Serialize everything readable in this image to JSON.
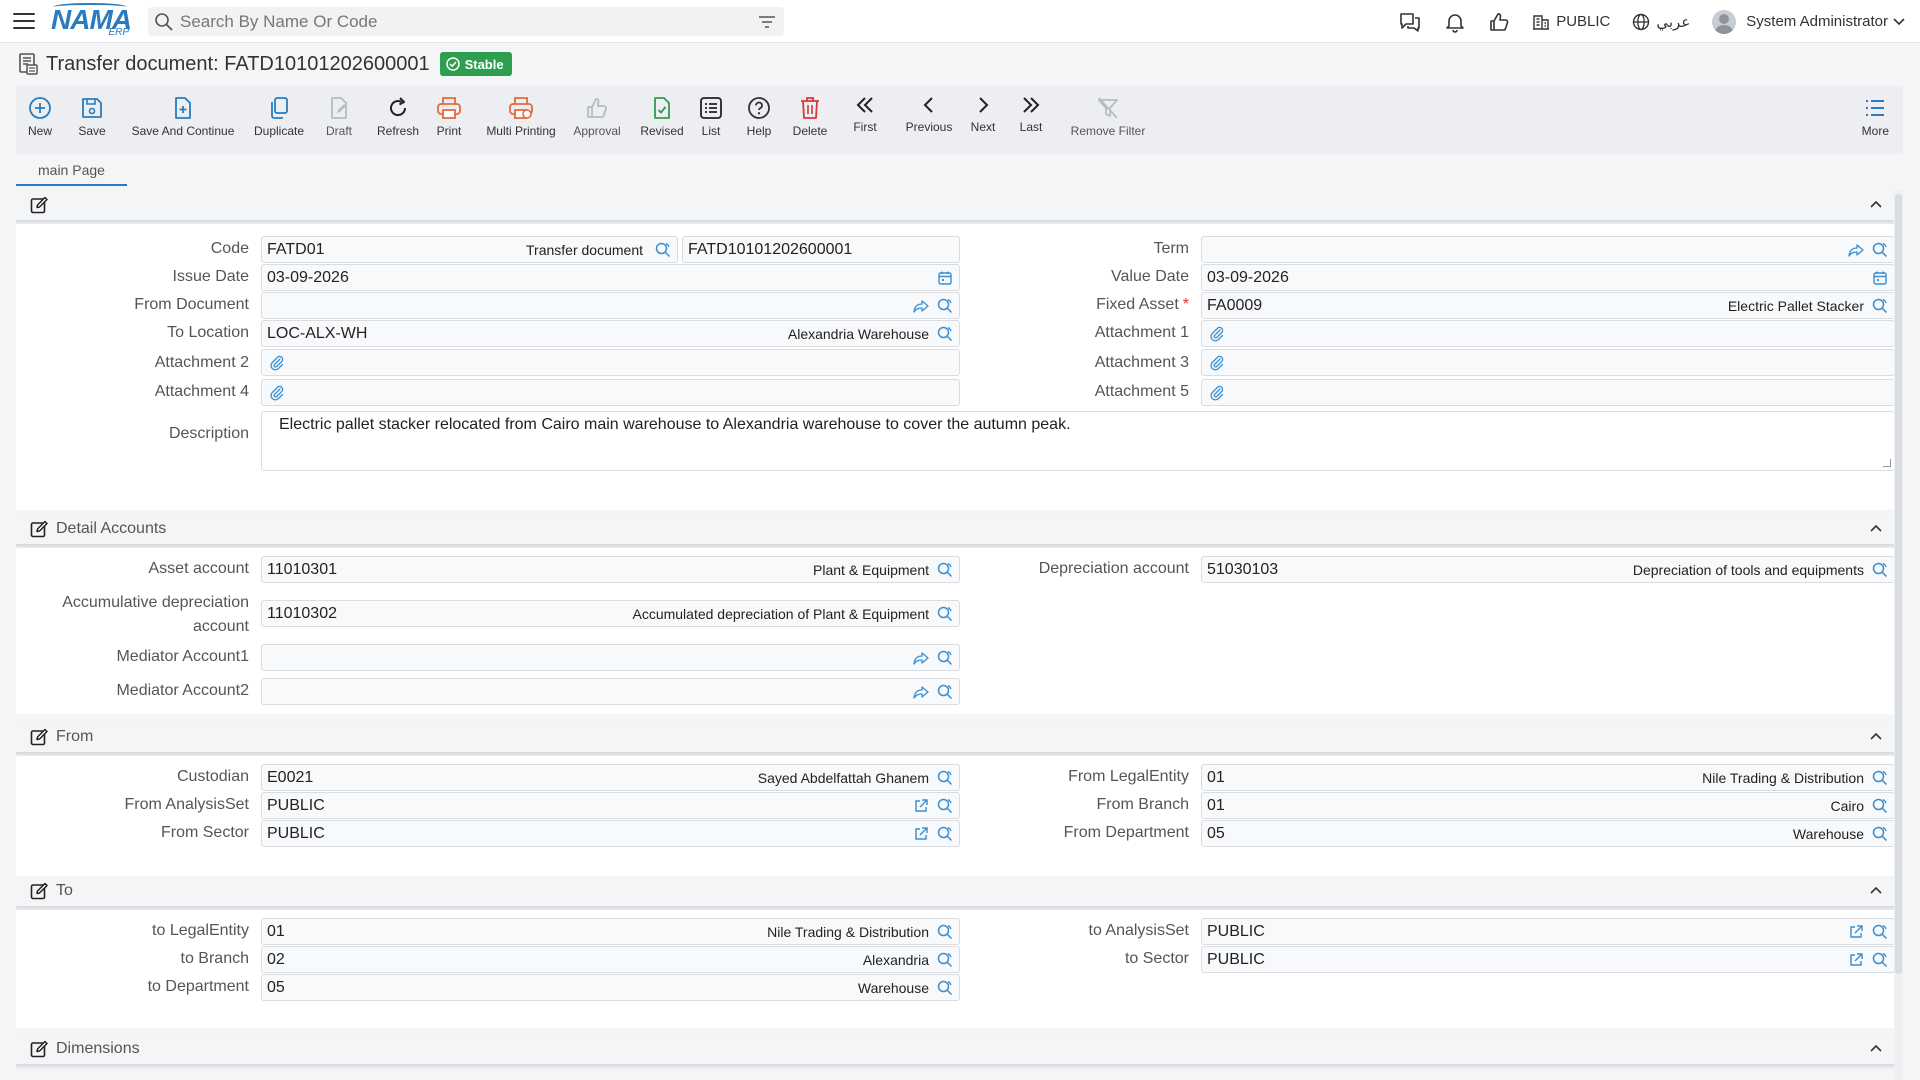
{
  "app": {
    "logo_text": "NAMA",
    "logo_sub": "ERP",
    "search_placeholder": "Search By Name Or Code",
    "org_label": "PUBLIC",
    "language_label": "عربي",
    "user_name": "System Administrator"
  },
  "page": {
    "title": "Transfer document: FATD10101202600001",
    "status": "Stable",
    "status_color": "#2e9e4f"
  },
  "toolbar": [
    {
      "id": "new",
      "label": "New",
      "icon": "plus-circle-icon"
    },
    {
      "id": "save",
      "label": "Save",
      "icon": "save-icon"
    },
    {
      "id": "save-continue",
      "label": "Save And Continue",
      "icon": "save-continue-icon"
    },
    {
      "id": "duplicate",
      "label": "Duplicate",
      "icon": "duplicate-icon"
    },
    {
      "id": "draft",
      "label": "Draft",
      "icon": "draft-icon"
    },
    {
      "id": "refresh",
      "label": "Refresh",
      "icon": "refresh-icon"
    },
    {
      "id": "print",
      "label": "Print",
      "icon": "printer-icon"
    },
    {
      "id": "multi-print",
      "label": "Multi Printing",
      "icon": "multi-printer-icon"
    },
    {
      "id": "approval",
      "label": "Approval",
      "icon": "thumbs-up-icon"
    },
    {
      "id": "revised",
      "label": "Revised",
      "icon": "revised-icon"
    },
    {
      "id": "list",
      "label": "List",
      "icon": "list-icon"
    },
    {
      "id": "help",
      "label": "Help",
      "icon": "help-icon"
    },
    {
      "id": "delete",
      "label": "Delete",
      "icon": "trash-icon"
    },
    {
      "id": "first",
      "label": "First",
      "icon": "double-chevron-left-icon"
    },
    {
      "id": "previous",
      "label": "Previous",
      "icon": "chevron-left-icon"
    },
    {
      "id": "next",
      "label": "Next",
      "icon": "chevron-right-icon"
    },
    {
      "id": "last",
      "label": "Last",
      "icon": "double-chevron-right-icon"
    },
    {
      "id": "remove-filter",
      "label": "Remove Filter",
      "icon": "remove-filter-icon"
    }
  ],
  "more_label": "More",
  "tabs": [
    {
      "label": "main Page"
    }
  ],
  "sections": {
    "detail_accounts": "Detail Accounts",
    "from": "From",
    "to": "To",
    "dimensions": "Dimensions"
  },
  "fields": {
    "code_label": "Code",
    "code_value": "FATD01",
    "code_desc": "Transfer document",
    "code_number": "FATD10101202600001",
    "term_label": "Term",
    "issue_date_label": "Issue Date",
    "issue_date_value": "03-09-2026",
    "value_date_label": "Value Date",
    "value_date_value": "03-09-2026",
    "from_document_label": "From Document",
    "fixed_asset_label": "Fixed Asset",
    "fixed_asset_required": "*",
    "fixed_asset_value": "FA0009",
    "fixed_asset_desc": "Electric Pallet Stacker",
    "to_location_label": "To Location",
    "to_location_value": "LOC-ALX-WH",
    "to_location_desc": "Alexandria Warehouse",
    "attachment1_label": "Attachment 1",
    "attachment2_label": "Attachment 2",
    "attachment3_label": "Attachment 3",
    "attachment4_label": "Attachment 4",
    "attachment5_label": "Attachment 5",
    "description_label": "Description",
    "description_value": "Electric pallet stacker relocated from Cairo main warehouse to Alexandria warehouse to cover the autumn peak.",
    "asset_account_label": "Asset account",
    "asset_account_value": "11010301",
    "asset_account_desc": "Plant & Equipment",
    "depreciation_account_label": "Depreciation account",
    "depreciation_account_value": "51030103",
    "depreciation_account_desc": "Depreciation of tools and equipments",
    "accum_dep_label_1": "Accumulative depreciation",
    "accum_dep_label_2": "account",
    "accum_dep_value": "11010302",
    "accum_dep_desc": "Accumulated depreciation of Plant & Equipment",
    "mediator1_label": "Mediator Account1",
    "mediator2_label": "Mediator Account2",
    "custodian_label": "Custodian",
    "custodian_value": "E0021",
    "custodian_desc": "Sayed Abdelfattah Ghanem",
    "from_legal_label": "From LegalEntity",
    "from_legal_value": "01",
    "from_legal_desc": "Nile Trading & Distribution",
    "from_analysis_label": "From AnalysisSet",
    "from_analysis_value": "PUBLIC",
    "from_branch_label": "From Branch",
    "from_branch_value": "01",
    "from_branch_desc": "Cairo",
    "from_sector_label": "From Sector",
    "from_sector_value": "PUBLIC",
    "from_department_label": "From Department",
    "from_department_value": "05",
    "from_department_desc": "Warehouse",
    "to_legal_label": "to LegalEntity",
    "to_legal_value": "01",
    "to_legal_desc": "Nile Trading & Distribution",
    "to_analysis_label": "to AnalysisSet",
    "to_analysis_value": "PUBLIC",
    "to_branch_label": "to Branch",
    "to_branch_value": "02",
    "to_branch_desc": "Alexandria",
    "to_sector_label": "to Sector",
    "to_sector_value": "PUBLIC",
    "to_department_label": "to Department",
    "to_department_value": "05",
    "to_department_desc": "Warehouse"
  },
  "colors": {
    "accent": "#2a7bbf",
    "print": "#e8693a",
    "delete": "#d9363e",
    "revised": "#2e9e4f"
  }
}
